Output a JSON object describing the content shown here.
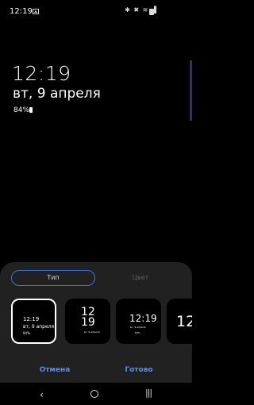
{
  "status_bar": {
    "time": "12:19",
    "icons": "✱ ✖ ≋ ▐"
  },
  "aod": {
    "time": "12:19",
    "date": "вт, 9 апреля",
    "battery": "84%"
  },
  "tabs": {
    "type": "Тип",
    "color": "Цвет"
  },
  "thumbnails": [
    {
      "time": "12:19",
      "date": "вт, 9 апреля",
      "battery": "84%"
    },
    {
      "hour": "12",
      "minute": "19",
      "small": "вт, 9 апреля"
    },
    {
      "time": "12:19",
      "date": "вт, 9 апреля",
      "battery": "84%"
    },
    {
      "time": "12"
    }
  ],
  "actions": {
    "cancel": "Отмена",
    "done": "Готово"
  },
  "nav": {
    "back": "‹",
    "recents": "|||"
  }
}
